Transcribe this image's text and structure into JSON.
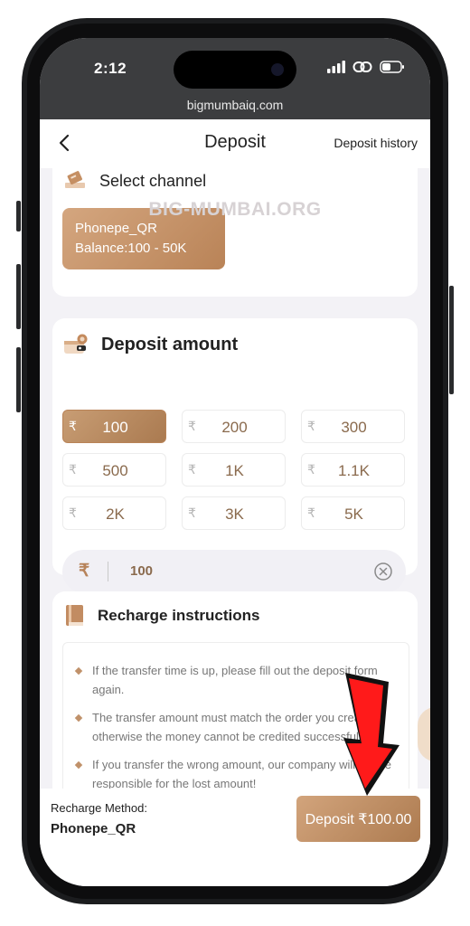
{
  "status_bar": {
    "time": "2:12",
    "url": "bigmumbaiq.com"
  },
  "header": {
    "title": "Deposit",
    "history_label": "Deposit history"
  },
  "channel": {
    "section_title": "Select channel",
    "name": "Phonepe_QR",
    "balance": "Balance:100 - 50K"
  },
  "watermark": "BIG-MUMBAI.ORG",
  "deposit_amount": {
    "section_title": "Deposit amount",
    "currency_symbol": "₹",
    "options": [
      "100",
      "200",
      "300",
      "500",
      "1K",
      "1.1K",
      "2K",
      "3K",
      "5K"
    ],
    "selected": "100",
    "input_value": "100"
  },
  "instructions": {
    "section_title": "Recharge instructions",
    "items": [
      "If the transfer time is up, please fill out the deposit form again.",
      "The transfer amount must match the order you created, otherwise the money cannot be credited successfully.",
      "If you transfer the wrong amount, our company will not be responsible for the lost amount!"
    ]
  },
  "footer": {
    "method_label": "Recharge Method:",
    "method_value": "Phonepe_QR",
    "deposit_button": "Deposit ₹100.00"
  },
  "colors": {
    "accent": "#b98357",
    "annotation_arrow": "#ff1a1a"
  }
}
